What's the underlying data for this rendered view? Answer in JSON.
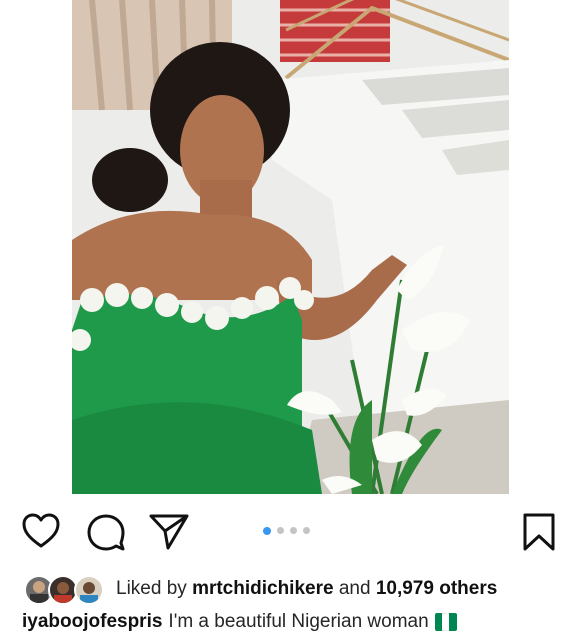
{
  "post": {
    "image_alt": "Woman in green dress with white flowers beside a staircase",
    "carousel": {
      "count": 4,
      "active_index": 1
    }
  },
  "actions": {
    "like_icon": "heart-outline-icon",
    "comment_icon": "comment-bubble-icon",
    "share_icon": "paper-plane-icon",
    "save_icon": "bookmark-outline-icon"
  },
  "likes": {
    "prefix": "Liked by",
    "user": "mrtchidichikere",
    "joiner": "and",
    "others": "10,979 others"
  },
  "caption": {
    "username": "iyaboojofespris",
    "text": "I'm a beautiful Nigerian woman",
    "emoji": "nigeria-flag",
    "flag_colors": [
      "#008751",
      "#ffffff",
      "#008751"
    ]
  },
  "colors": {
    "accent_blue": "#3897f0",
    "dress_green": "#1f9a4a"
  }
}
